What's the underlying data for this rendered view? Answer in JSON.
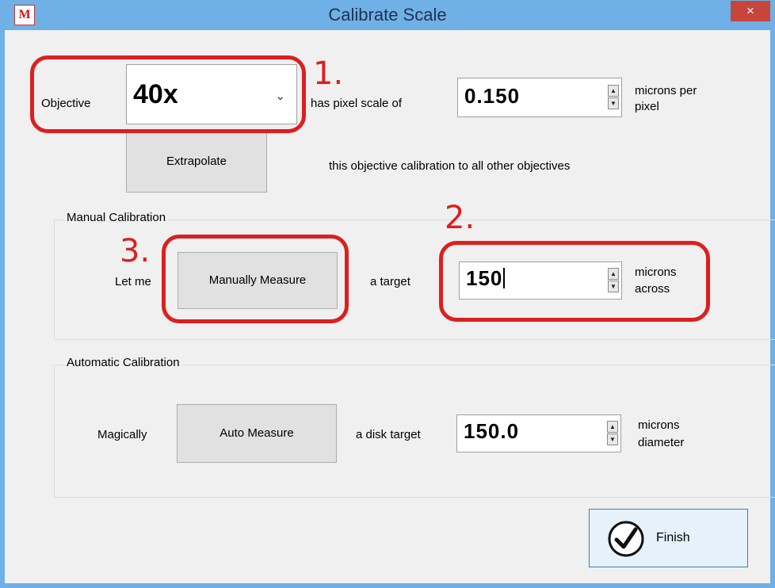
{
  "window": {
    "title": "Calibrate Scale",
    "close_label": "×",
    "logo": "M"
  },
  "objective": {
    "label": "Objective",
    "selected": "40x",
    "arrow": "⌄",
    "scale_label": "has pixel scale of",
    "scale_value": "0.150",
    "unit_line1": "microns per",
    "unit_line2": "pixel"
  },
  "extrapolate": {
    "button_label": "Extrapolate",
    "description": "this objective calibration to all other objectives"
  },
  "manual": {
    "group_title": "Manual Calibration",
    "prefix": "Let me",
    "button_label": "Manually Measure",
    "middle": "a target",
    "value": "150",
    "unit_line1": "microns",
    "unit_line2": "across"
  },
  "automatic": {
    "group_title": "Automatic Calibration",
    "prefix": "Magically",
    "button_label": "Auto Measure",
    "middle": "a disk target",
    "value": "150.0",
    "unit_line1": "microns",
    "unit_line2": "diameter"
  },
  "finish": {
    "label": "Finish"
  },
  "annotations": {
    "one": "1.",
    "two": "2.",
    "three": "3."
  },
  "spin": {
    "up": "▲",
    "down": "▼"
  },
  "colors": {
    "titlebar": "#6fb0e6",
    "close": "#c7453b",
    "annotation": "#dc1f1f",
    "dialog_bg": "#f0f0f0"
  }
}
